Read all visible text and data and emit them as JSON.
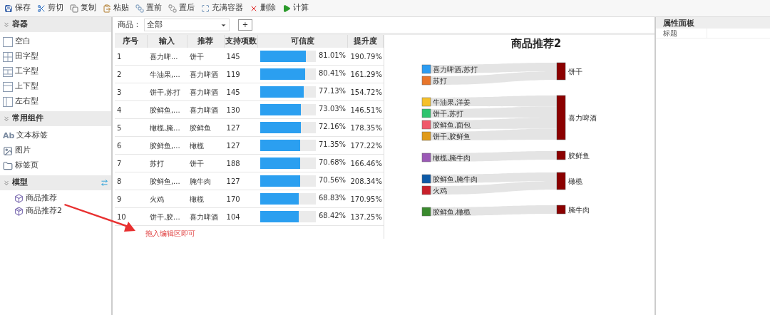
{
  "toolbar": [
    {
      "label": "保存"
    },
    {
      "label": "剪切"
    },
    {
      "label": "复制"
    },
    {
      "label": "粘贴"
    },
    {
      "label": "置前"
    },
    {
      "label": "置后"
    },
    {
      "label": "充满容器"
    },
    {
      "label": "删除"
    },
    {
      "label": "计算"
    }
  ],
  "sidebar": {
    "sections": [
      {
        "title": "容器",
        "expanded": true,
        "items": [
          {
            "label": "空白"
          },
          {
            "label": "田字型"
          },
          {
            "label": "工字型"
          },
          {
            "label": "上下型"
          },
          {
            "label": "左右型"
          }
        ]
      },
      {
        "title": "常用组件",
        "expanded": true,
        "items": [
          {
            "label": "文本标签",
            "icon_text": "Ab"
          },
          {
            "label": "图片"
          },
          {
            "label": "标签页"
          }
        ]
      },
      {
        "title": "模型",
        "expanded": true,
        "items": [
          {
            "label": "商品推荐"
          },
          {
            "label": "商品推荐2"
          }
        ]
      }
    ]
  },
  "filter": {
    "label": "商品：",
    "value": "全部",
    "add_button": "+"
  },
  "table": {
    "columns": [
      "序号",
      "输入",
      "推荐",
      "支持项数",
      "可信度",
      "提升度"
    ],
    "rows": [
      {
        "index": "1",
        "input": "喜力啤...",
        "recommend": "饼干",
        "support": "145",
        "level": 0.8101,
        "confidence": "81.01%",
        "lift": "190.79%"
      },
      {
        "index": "2",
        "input": "牛油果,...",
        "recommend": "喜力啤酒",
        "support": "119",
        "level": 0.8041,
        "confidence": "80.41%",
        "lift": "161.29%"
      },
      {
        "index": "3",
        "input": "饼干,苏打",
        "recommend": "喜力啤酒",
        "support": "145",
        "level": 0.7713,
        "confidence": "77.13%",
        "lift": "154.72%"
      },
      {
        "index": "4",
        "input": "胶鲜鱼,...",
        "recommend": "喜力啤酒",
        "support": "130",
        "level": 0.7303,
        "confidence": "73.03%",
        "lift": "146.51%"
      },
      {
        "index": "5",
        "input": "橄榄,腌...",
        "recommend": "胶鲜鱼",
        "support": "127",
        "level": 0.7216,
        "confidence": "72.16%",
        "lift": "178.35%"
      },
      {
        "index": "6",
        "input": "胶鲜鱼,...",
        "recommend": "橄榄",
        "support": "127",
        "level": 0.7135,
        "confidence": "71.35%",
        "lift": "177.22%"
      },
      {
        "index": "7",
        "input": "苏打",
        "recommend": "饼干",
        "support": "188",
        "level": 0.7068,
        "confidence": "70.68%",
        "lift": "166.46%"
      },
      {
        "index": "8",
        "input": "胶鲜鱼,...",
        "recommend": "腌牛肉",
        "support": "127",
        "level": 0.7056,
        "confidence": "70.56%",
        "lift": "208.34%"
      },
      {
        "index": "9",
        "input": "火鸡",
        "recommend": "橄榄",
        "support": "170",
        "level": 0.6883,
        "confidence": "68.83%",
        "lift": "170.95%"
      },
      {
        "index": "10",
        "input": "饼干,胶...",
        "recommend": "喜力啤酒",
        "support": "104",
        "level": 0.6842,
        "confidence": "68.42%",
        "lift": "137.25%"
      }
    ]
  },
  "hint": "拖入编辑区即可",
  "sankey": {
    "title": "商品推荐2",
    "groups": [
      {
        "target": "饼干",
        "sources": [
          {
            "label": "喜力啤酒,苏打",
            "color": "#2b9cf2"
          },
          {
            "label": "苏打",
            "color": "#e8762b"
          }
        ]
      },
      {
        "target": "喜力啤酒",
        "sources": [
          {
            "label": "牛油果,洋姜",
            "color": "#f5c02a"
          },
          {
            "label": "饼干,苏打",
            "color": "#2ec46e"
          },
          {
            "label": "胶鲜鱼,面包",
            "color": "#f0586a"
          },
          {
            "label": "饼干,胶鲜鱼",
            "color": "#e09a1a"
          }
        ]
      },
      {
        "target": "胶鲜鱼",
        "sources": [
          {
            "label": "橄榄,腌牛肉",
            "color": "#9b59b6"
          }
        ]
      },
      {
        "target": "橄榄",
        "sources": [
          {
            "label": "胶鲜鱼,腌牛肉",
            "color": "#0d5aa7"
          },
          {
            "label": "火鸡",
            "color": "#c8202a"
          }
        ]
      },
      {
        "target": "腌牛肉",
        "sources": [
          {
            "label": "胶鲜鱼,橄榄",
            "color": "#3a8a2e"
          }
        ]
      }
    ]
  },
  "properties": {
    "title": "属性面板",
    "rows": [
      {
        "label": "标题"
      }
    ]
  }
}
